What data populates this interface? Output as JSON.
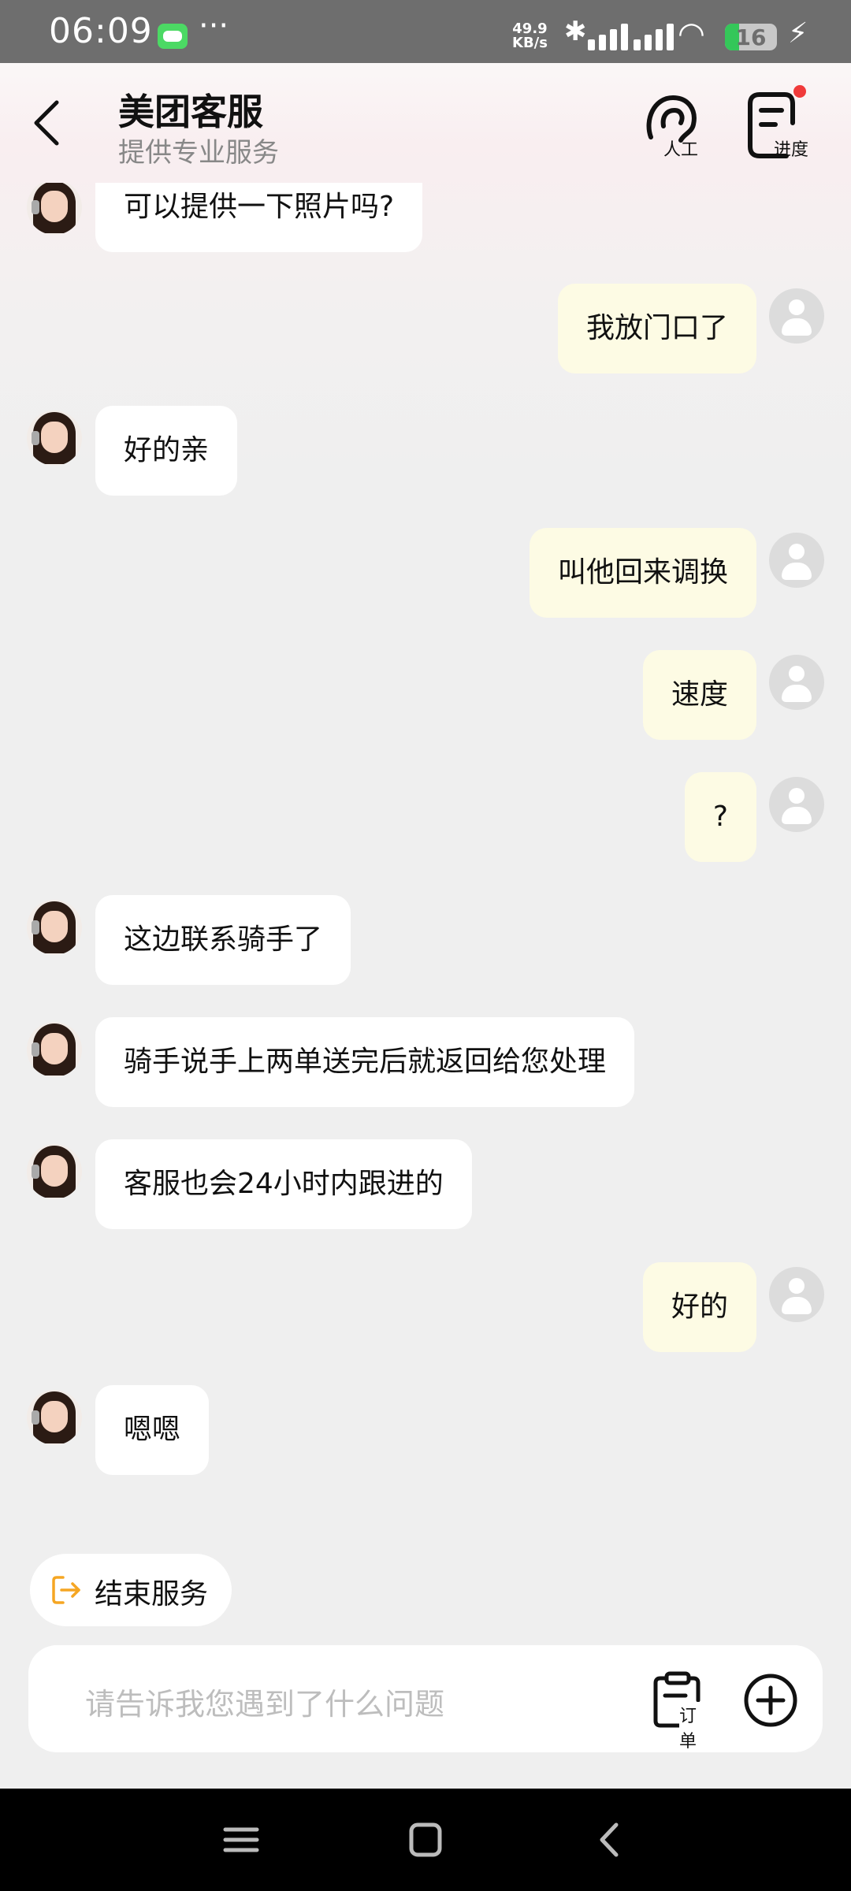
{
  "status_bar": {
    "time": "06:09",
    "more": "···",
    "speed_value": "49.9",
    "speed_unit": "KB/s",
    "battery": "16"
  },
  "header": {
    "title": "美团客服",
    "subtitle": "提供专业服务",
    "human_label": "人工",
    "progress_label": "进度"
  },
  "messages": [
    {
      "from": "agent",
      "text": "可以提供一下照片吗?"
    },
    {
      "from": "user",
      "text": "我放门口了"
    },
    {
      "from": "agent",
      "text": "好的亲"
    },
    {
      "from": "user",
      "text": "叫他回来调换"
    },
    {
      "from": "user",
      "text": "速度"
    },
    {
      "from": "user",
      "text": "?"
    },
    {
      "from": "agent",
      "text": "这边联系骑手了"
    },
    {
      "from": "agent",
      "text": "骑手说手上两单送完后就返回给您处理"
    },
    {
      "from": "agent",
      "text": "客服也会24小时内跟进的"
    },
    {
      "from": "user",
      "text": "好的"
    },
    {
      "from": "agent",
      "text": "嗯嗯"
    }
  ],
  "end_service": "结束服务",
  "input": {
    "placeholder": "请告诉我您遇到了什么问题",
    "order_label": "订单"
  },
  "colors": {
    "agent_bubble": "#ffffff",
    "user_bubble": "#fdfbe4",
    "accent_orange": "#f5a623",
    "badge_red": "#f03a3a"
  },
  "icons": [
    "back-icon",
    "headset-icon",
    "progress-icon",
    "exit-icon",
    "order-icon",
    "plus-icon"
  ]
}
